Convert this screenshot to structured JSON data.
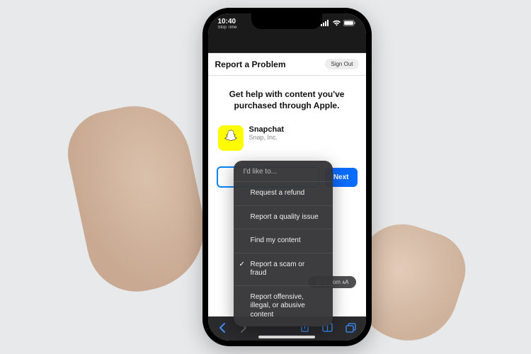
{
  "status": {
    "time": "10:40",
    "sub": "Stop Time"
  },
  "page": {
    "title": "Report a Problem",
    "sign_out": "Sign Out",
    "hero": "Get help with content you've purchased through Apple."
  },
  "app": {
    "name": "Snapchat",
    "publisher": "Snap, Inc."
  },
  "actions": {
    "next": "Next"
  },
  "dropdown": {
    "header": "I'd like to...",
    "items": [
      {
        "label": "Request a refund",
        "selected": false
      },
      {
        "label": "Report a quality issue",
        "selected": false
      },
      {
        "label": "Find my content",
        "selected": false
      },
      {
        "label": "Report a scam or fraud",
        "selected": true
      },
      {
        "label": "Report offensive, illegal, or abusive content",
        "selected": false
      }
    ]
  },
  "browser": {
    "url_fragment": "le.com"
  }
}
